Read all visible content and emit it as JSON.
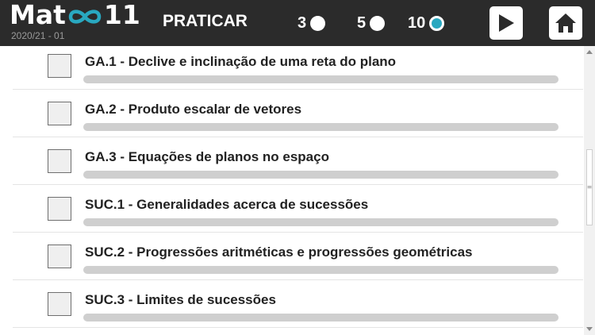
{
  "header": {
    "logo": {
      "left": "Mat",
      "right": "11"
    },
    "season": "2020/21 - 01",
    "mode_title": "PRATICAR",
    "question_counts": [
      {
        "label": "3",
        "selected": false
      },
      {
        "label": "5",
        "selected": false
      },
      {
        "label": "10",
        "selected": true
      }
    ],
    "play_icon": "play-icon",
    "home_icon": "home-icon",
    "accent_color": "#29a8c0",
    "header_color": "#2b2b2b"
  },
  "topics": [
    {
      "title": "GA.1 - Declive e inclinação de uma reta do plano",
      "checked": false,
      "progress": 0
    },
    {
      "title": "GA.2 - Produto escalar de vetores",
      "checked": false,
      "progress": 0
    },
    {
      "title": "GA.3 - Equações de planos no espaço",
      "checked": false,
      "progress": 0
    },
    {
      "title": "SUC.1 - Generalidades acerca de sucessões",
      "checked": false,
      "progress": 0
    },
    {
      "title": "SUC.2 - Progressões aritméticas e progressões geométricas",
      "checked": false,
      "progress": 0
    },
    {
      "title": "SUC.3 - Limites de sucessões",
      "checked": false,
      "progress": 0
    }
  ]
}
